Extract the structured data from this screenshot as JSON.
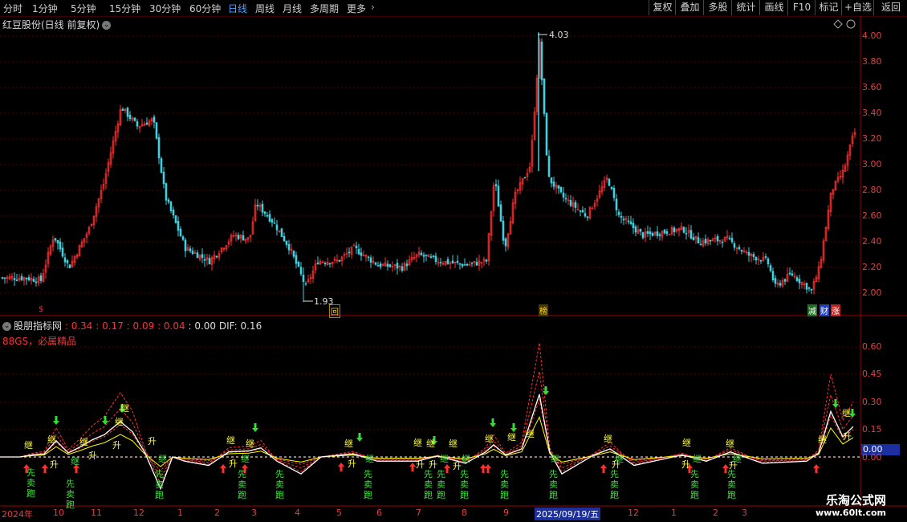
{
  "toolbar": {
    "periods": [
      "分时",
      "1分钟",
      "5分钟",
      "15分钟",
      "30分钟",
      "60分钟",
      "日线",
      "周线",
      "月线",
      "多周期",
      "更多"
    ],
    "active_period": "日线",
    "right_buttons": [
      "复权",
      "叠加",
      "多股",
      "统计",
      "画线",
      "F10",
      "标记",
      "+自选",
      "返回"
    ]
  },
  "stock": {
    "title": "红豆股份(日线 前复权)"
  },
  "price_panel": {
    "axis_labels": [
      "4.00",
      "3.80",
      "3.60",
      "3.40",
      "3.20",
      "3.00",
      "2.80",
      "2.60",
      "2.40",
      "2.20",
      "2.00"
    ],
    "high_label": "4.03",
    "low_label": "1.93",
    "markers": [
      {
        "text": "$",
        "color": "#ff3030"
      },
      {
        "text": "回",
        "color": "#ffd700"
      },
      {
        "text": "榜",
        "color": "#ffd700"
      },
      {
        "text": "减",
        "color": "#30c030"
      },
      {
        "text": "财",
        "color": "#4060ff"
      },
      {
        "text": "涨",
        "color": "#ff3030"
      }
    ]
  },
  "indicator": {
    "name": "股朋指标网",
    "values": [
      "0.34",
      "0.17",
      "0.09",
      "0.04"
    ],
    "extra_value": "0.00",
    "dif_label": "DIF: 0.16",
    "subtitle": "88GS，必属精品",
    "axis_labels": [
      "0.60",
      "0.45",
      "0.30",
      "0.15",
      "0.00"
    ],
    "current_value_box": "0.00",
    "signals": {
      "ji": "继",
      "sheng": "升",
      "xian": "先",
      "mai": "卖",
      "pao": "跑"
    }
  },
  "x_axis": {
    "labels": [
      "2024年",
      "10",
      "11",
      "12",
      "1",
      "2",
      "3",
      "4",
      "5",
      "6",
      "7",
      "8",
      "9",
      "2025/09/19/五",
      "12",
      "1",
      "2",
      "3"
    ],
    "selected": "2025/09/19/五"
  },
  "watermark": {
    "text": "乐淘公式网",
    "url": "www.60lt.com"
  },
  "colors": {
    "up": "#ff3030",
    "down": "#40d0e0",
    "ma": "#ffffff",
    "grid": "#5a0000",
    "dashed": "#ff3030"
  }
}
